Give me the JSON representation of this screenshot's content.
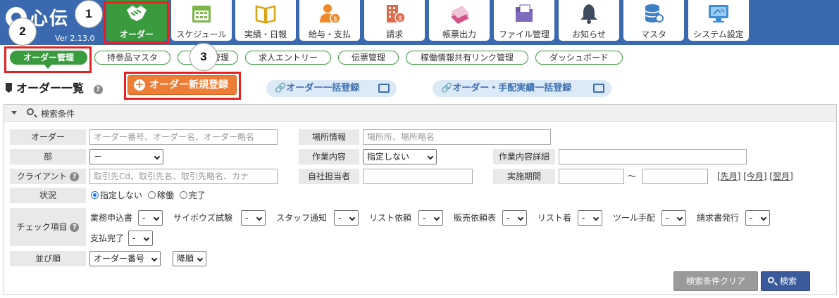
{
  "app": {
    "logo_text": "心伝",
    "version": "Ver 2.13.0"
  },
  "nav": [
    {
      "label": "オーダー",
      "icon": "handshake-icon",
      "active": true
    },
    {
      "label": "スケジュール",
      "icon": "calendar-icon"
    },
    {
      "label": "実績・日報",
      "icon": "book-icon"
    },
    {
      "label": "給与・支払",
      "icon": "person-money-icon"
    },
    {
      "label": "請求",
      "icon": "building-money-icon"
    },
    {
      "label": "帳票出力",
      "icon": "papers-icon"
    },
    {
      "label": "ファイル管理",
      "icon": "folder-icon"
    },
    {
      "label": "お知らせ",
      "icon": "bell-icon"
    },
    {
      "label": "マスタ",
      "icon": "database-gear-icon"
    },
    {
      "label": "システム設定",
      "icon": "monitor-settings-icon"
    }
  ],
  "subnav": [
    {
      "label": "オーダー管理",
      "active": true
    },
    {
      "label": "持参品マスタ"
    },
    {
      "label": "ト管理"
    },
    {
      "label": "求人エントリー"
    },
    {
      "label": "伝票管理"
    },
    {
      "label": "稼働情報共有リンク管理"
    },
    {
      "label": "ダッシュボード"
    }
  ],
  "markers": [
    "1",
    "2",
    "3"
  ],
  "page": {
    "title": "オーダー一覧",
    "help": "?",
    "new_button": "オーダー新規登録",
    "bulk_link": "オーダー一括登録",
    "bulk_link2": "オーダー・手配実績一括登録"
  },
  "search": {
    "title": "検索条件",
    "order_label": "オーダー",
    "order_placeholder": "オーダー番号、オーダー名、オーダー略名",
    "place_label": "場所情報",
    "place_placeholder": "場所所、場所略名",
    "dept_label": "部",
    "dept_value": "－",
    "work_label": "作業内容",
    "work_value": "指定しない",
    "work_detail_label": "作業内容詳細",
    "client_label": "クライアント",
    "client_placeholder": "取引先Cd、取引先名、取引先略名、カナ",
    "staff_label": "自社担当者",
    "period_label": "実施期間",
    "tilde": "～",
    "prev_month": "先月",
    "this_month": "今月",
    "next_month": "翌月",
    "status_label": "状況",
    "status_options": [
      "指定しない",
      "稼働",
      "完了"
    ],
    "check_label": "チェック項目",
    "check_items": [
      {
        "label": "業務申込書",
        "value": "-"
      },
      {
        "label": "サイボウズ試験",
        "value": "-"
      },
      {
        "label": "スタッフ通知",
        "value": "-"
      },
      {
        "label": "リスト依頼",
        "value": "-"
      },
      {
        "label": "販売依頼表",
        "value": "-"
      },
      {
        "label": "リスト着",
        "value": "-"
      },
      {
        "label": "ツール手配",
        "value": "-"
      },
      {
        "label": "請求書発行",
        "value": "-"
      },
      {
        "label": "支払完了",
        "value": "-"
      }
    ],
    "sort_label": "並び順",
    "sort_field": "オーダー番号",
    "sort_dir": "降順",
    "clear_button": "検索条件クリア",
    "search_button": "検索"
  },
  "colors": {
    "nav_bg": "#3a69b0",
    "accent_green": "#3a9a3e",
    "accent_orange": "#ee7d36",
    "callout_red": "#e82020"
  }
}
